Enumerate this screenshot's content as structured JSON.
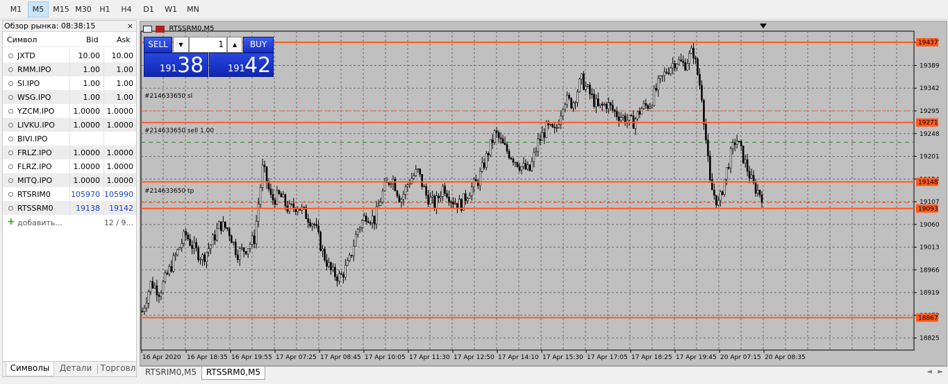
{
  "toolbar": {
    "timeframes": [
      "M1",
      "M5",
      "M15",
      "M30",
      "H1",
      "H4",
      "D1",
      "W1",
      "MN"
    ],
    "active": "M5"
  },
  "market_watch": {
    "title": "Обзор рынка: 08:38:15",
    "close": "×",
    "columns": [
      "Символ",
      "Bid",
      "Ask"
    ],
    "rows": [
      {
        "symbol": "JXTD",
        "bid": "10.00",
        "ask": "10.00"
      },
      {
        "symbol": "RMM.IPO",
        "bid": "1.00",
        "ask": "1.00"
      },
      {
        "symbol": "SI.IPO",
        "bid": "1.00",
        "ask": "1.00"
      },
      {
        "symbol": "WSG.IPO",
        "bid": "1.00",
        "ask": "1.00"
      },
      {
        "symbol": "YZCM.IPO",
        "bid": "1.0000",
        "ask": "1.0000"
      },
      {
        "symbol": "LIVKU.IPO",
        "bid": "1.0000",
        "ask": "1.0000"
      },
      {
        "symbol": "BIVI.IPO",
        "bid": "",
        "ask": ""
      },
      {
        "symbol": "FRLZ.IPO",
        "bid": "1.0000",
        "ask": "1.0000"
      },
      {
        "symbol": "FLRZ.IPO",
        "bid": "1.0000",
        "ask": "1.0000"
      },
      {
        "symbol": "MITQ.IPO",
        "bid": "1.0000",
        "ask": "1.0000"
      },
      {
        "symbol": "RTSRIM0",
        "bid": "105970",
        "ask": "105990"
      },
      {
        "symbol": "RTSSRM0",
        "bid": "19138",
        "ask": "19142"
      }
    ],
    "add_label": "добавить...",
    "count": "12 / 9...",
    "tabs": [
      "Символы",
      "Детали",
      "Торговл"
    ]
  },
  "chart": {
    "title": "RTSSRM0,M5",
    "trade": {
      "sell_label": "SELL",
      "buy_label": "BUY",
      "volume": "1",
      "sell_small": "191",
      "sell_big": "38",
      "buy_small": "191",
      "buy_big": "42"
    },
    "order_labels": [
      "#214633650 sl",
      "#214633650 sell 1.00",
      "#214633650 tp"
    ],
    "colors": {
      "bg": "#c0c0c0",
      "level": "#ff5a1e",
      "grid": "#808080"
    }
  },
  "chart_data": {
    "type": "candlestick",
    "price_ticks": [
      "19437",
      "19389",
      "19342",
      "19295",
      "19248",
      "19201",
      "19154",
      "19107",
      "19060",
      "19013",
      "18966",
      "18919",
      "18872",
      "18825"
    ],
    "highlighted_levels": [
      "19437",
      "19271",
      "19148",
      "19093",
      "18867"
    ],
    "time_labels": [
      "16 Apr 2020",
      "16 Apr 18:35",
      "16 Apr 19:55",
      "17 Apr 07:25",
      "17 Apr 08:45",
      "17 Apr 10:05",
      "17 Apr 11:30",
      "17 Apr 12:50",
      "17 Apr 14:10",
      "17 Apr 15:30",
      "17 Apr 17:05",
      "17 Apr 18:25",
      "17 Apr 19:45",
      "20 Apr 07:15",
      "20 Apr 08:35"
    ],
    "price_range": [
      18800,
      19460
    ],
    "close_path": [
      18880,
      18940,
      18920,
      18960,
      19000,
      19040,
      19010,
      18990,
      19020,
      19060,
      19050,
      19000,
      19010,
      19030,
      19180,
      19110,
      19120,
      19090,
      19100,
      19080,
      19060,
      19000,
      18960,
      18950,
      18980,
      19050,
      19080,
      19070,
      19130,
      19160,
      19110,
      19150,
      19170,
      19120,
      19100,
      19140,
      19110,
      19100,
      19130,
      19150,
      19200,
      19250,
      19220,
      19200,
      19180,
      19170,
      19230,
      19260,
      19250,
      19320,
      19310,
      19360,
      19330,
      19300,
      19310,
      19290,
      19280,
      19270,
      19300,
      19310,
      19350,
      19380,
      19400,
      19390,
      19420,
      19330,
      19140,
      19100,
      19180,
      19240,
      19190,
      19140,
      19120
    ]
  },
  "bottom_tabs": [
    "RTSRIM0,M5",
    "RTSSRM0,M5"
  ],
  "bottom_active": "RTSSRM0,M5"
}
